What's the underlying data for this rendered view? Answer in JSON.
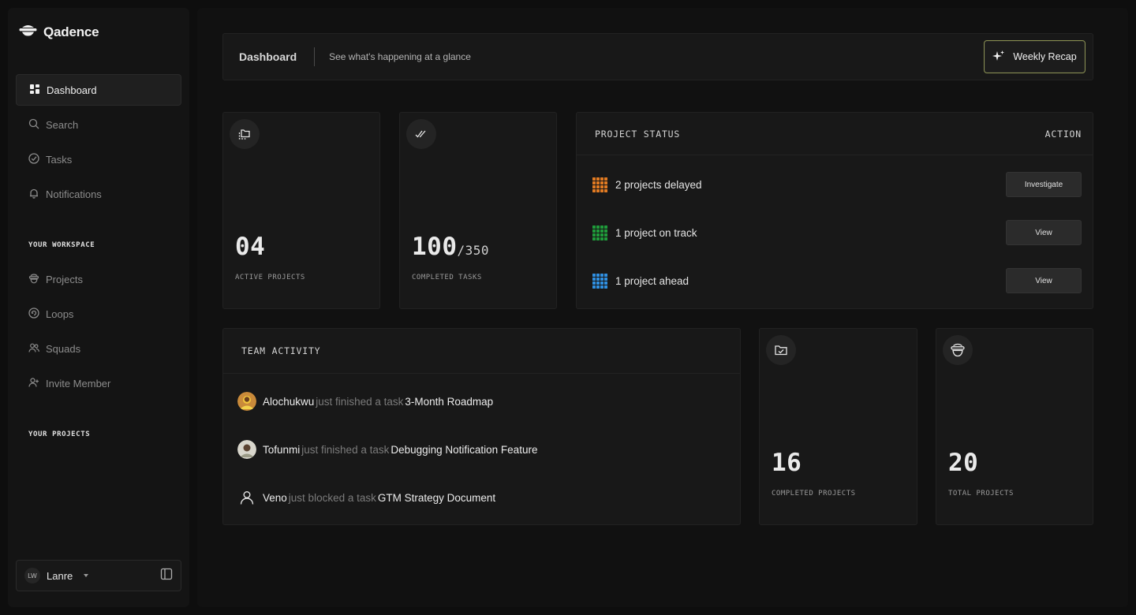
{
  "brand": {
    "name": "Qadence"
  },
  "nav": {
    "primary": [
      {
        "label": "Dashboard",
        "icon": "dashboard-icon",
        "active": true
      },
      {
        "label": "Search",
        "icon": "search-icon"
      },
      {
        "label": "Tasks",
        "icon": "tasks-icon"
      },
      {
        "label": "Notifications",
        "icon": "bell-icon"
      }
    ],
    "workspace_label": "YOUR WORKSPACE",
    "workspace": [
      {
        "label": "Projects",
        "icon": "projects-icon"
      },
      {
        "label": "Loops",
        "icon": "loops-icon"
      },
      {
        "label": "Squads",
        "icon": "squads-icon"
      },
      {
        "label": "Invite Member",
        "icon": "invite-member-icon"
      }
    ],
    "projects_label": "YOUR PROJECTS"
  },
  "user": {
    "initials": "LW",
    "name": "Lanre"
  },
  "header": {
    "title": "Dashboard",
    "subtitle": "See what's happening at a glance",
    "recap_label": "Weekly Recap"
  },
  "stats": {
    "active_projects": {
      "value": "04",
      "label": "ACTIVE PROJECTS"
    },
    "completed_tasks": {
      "value": "100",
      "total": "/350",
      "label": "COMPLETED TASKS"
    },
    "completed_projects": {
      "value": "16",
      "label": "COMPLETED PROJECTS"
    },
    "total_projects": {
      "value": "20",
      "label": "TOTAL PROJECTS"
    }
  },
  "project_status": {
    "title": "PROJECT STATUS",
    "action_header": "ACTION",
    "rows": [
      {
        "text": "2 projects delayed",
        "action": "Investigate",
        "color": "#e07a22"
      },
      {
        "text": "1 project on track",
        "action": "View",
        "color": "#1f9b3a"
      },
      {
        "text": "1 project ahead",
        "action": "View",
        "color": "#2f8fe0"
      }
    ]
  },
  "team_activity": {
    "title": "TEAM ACTIVITY",
    "items": [
      {
        "name": "Alochukwu",
        "verb": "just finished a task",
        "task": "3-Month Roadmap"
      },
      {
        "name": "Tofunmi",
        "verb": "just finished a task",
        "task": "Debugging Notification Feature"
      },
      {
        "name": "Veno",
        "verb": "just blocked a task",
        "task": "GTM Strategy Document"
      }
    ]
  },
  "colors": {
    "background": "#0e0e0e",
    "panel": "#141414",
    "card": "#181818",
    "recap_border": "#8a8f52"
  }
}
